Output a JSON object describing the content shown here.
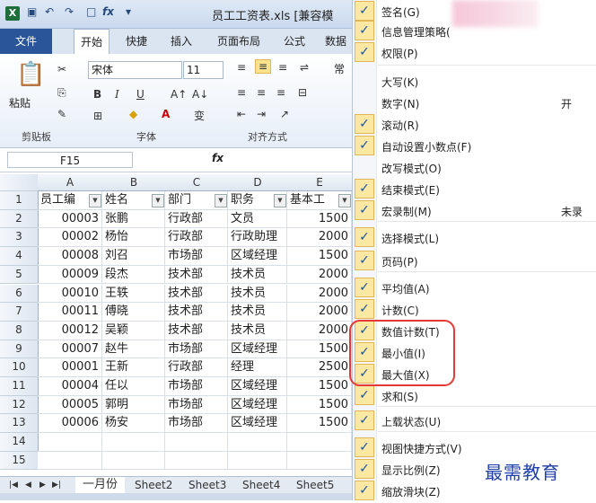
{
  "window": {
    "title": "员工工资表.xls [兼容模"
  },
  "ribbon": {
    "tabs": [
      "文件",
      "开始",
      "快捷",
      "插入",
      "页面布局",
      "公式",
      "数据"
    ],
    "font_name": "宋体",
    "font_size": "11",
    "paste_label": "粘贴",
    "groups": [
      "剪贴板",
      "字体",
      "对齐方式"
    ],
    "normal_label": "常"
  },
  "formula_bar": {
    "name_box": "F15",
    "fx": "fx"
  },
  "grid": {
    "columns": [
      "A",
      "B",
      "C",
      "D",
      "E"
    ],
    "rows": [
      [
        "员工编",
        "姓名",
        "部门",
        "职务",
        "基本工"
      ],
      [
        "00003",
        "张鹏",
        "行政部",
        "文员",
        "1500"
      ],
      [
        "00002",
        "杨怡",
        "行政部",
        "行政助理",
        "2000"
      ],
      [
        "00008",
        "刘召",
        "市场部",
        "区域经理",
        "1500"
      ],
      [
        "00009",
        "段杰",
        "技术部",
        "技术员",
        "2000"
      ],
      [
        "00010",
        "王轶",
        "技术部",
        "技术员",
        "2000"
      ],
      [
        "00011",
        "傅晓",
        "技术部",
        "技术员",
        "2000"
      ],
      [
        "00012",
        "吴颖",
        "技术部",
        "技术员",
        "2000"
      ],
      [
        "00007",
        "赵牛",
        "市场部",
        "区域经理",
        "1500"
      ],
      [
        "00001",
        "王新",
        "行政部",
        "经理",
        "2500"
      ],
      [
        "00004",
        "任以",
        "市场部",
        "区域经理",
        "1500"
      ],
      [
        "00005",
        "郭明",
        "市场部",
        "区域经理",
        "1500"
      ],
      [
        "00006",
        "杨安",
        "市场部",
        "区域经理",
        "1500"
      ],
      [
        "",
        "",
        "",
        "",
        ""
      ],
      [
        "",
        "",
        "",
        "",
        ""
      ]
    ],
    "row_numbers": [
      "1",
      "2",
      "3",
      "4",
      "5",
      "6",
      "7",
      "8",
      "9",
      "10",
      "11",
      "12",
      "13",
      "14",
      "15"
    ]
  },
  "sheet_tabs": [
    "一月份",
    "Sheet2",
    "Sheet3",
    "Sheet4",
    "Sheet5"
  ],
  "menu": {
    "items": [
      {
        "label": "签名(G)",
        "checked": true,
        "value": ""
      },
      {
        "label": "信息管理策略(",
        "checked": true,
        "value": ""
      },
      {
        "label": "权限(P)",
        "checked": true,
        "value": ""
      },
      {
        "label": "大写(K)",
        "checked": false,
        "value": ""
      },
      {
        "label": "数字(N)",
        "checked": false,
        "value": "开"
      },
      {
        "label": "滚动(R)",
        "checked": true,
        "value": ""
      },
      {
        "label": "自动设置小数点(F)",
        "checked": true,
        "value": ""
      },
      {
        "label": "改写模式(O)",
        "checked": false,
        "value": ""
      },
      {
        "label": "结束模式(E)",
        "checked": true,
        "value": ""
      },
      {
        "label": "宏录制(M)",
        "checked": true,
        "value": "未录"
      },
      {
        "label": "选择模式(L)",
        "checked": true,
        "value": ""
      },
      {
        "label": "页码(P)",
        "checked": true,
        "value": ""
      },
      {
        "label": "平均值(A)",
        "checked": true,
        "value": ""
      },
      {
        "label": "计数(C)",
        "checked": true,
        "value": ""
      },
      {
        "label": "数值计数(T)",
        "checked": true,
        "value": ""
      },
      {
        "label": "最小值(I)",
        "checked": true,
        "value": ""
      },
      {
        "label": "最大值(X)",
        "checked": true,
        "value": ""
      },
      {
        "label": "求和(S)",
        "checked": true,
        "value": ""
      },
      {
        "label": "上载状态(U)",
        "checked": true,
        "value": ""
      },
      {
        "label": "视图快捷方式(V)",
        "checked": true,
        "value": ""
      },
      {
        "label": "显示比例(Z)",
        "checked": true,
        "value": ""
      },
      {
        "label": "缩放滑块(Z)",
        "checked": true,
        "value": ""
      }
    ]
  },
  "watermark": "最需教育"
}
